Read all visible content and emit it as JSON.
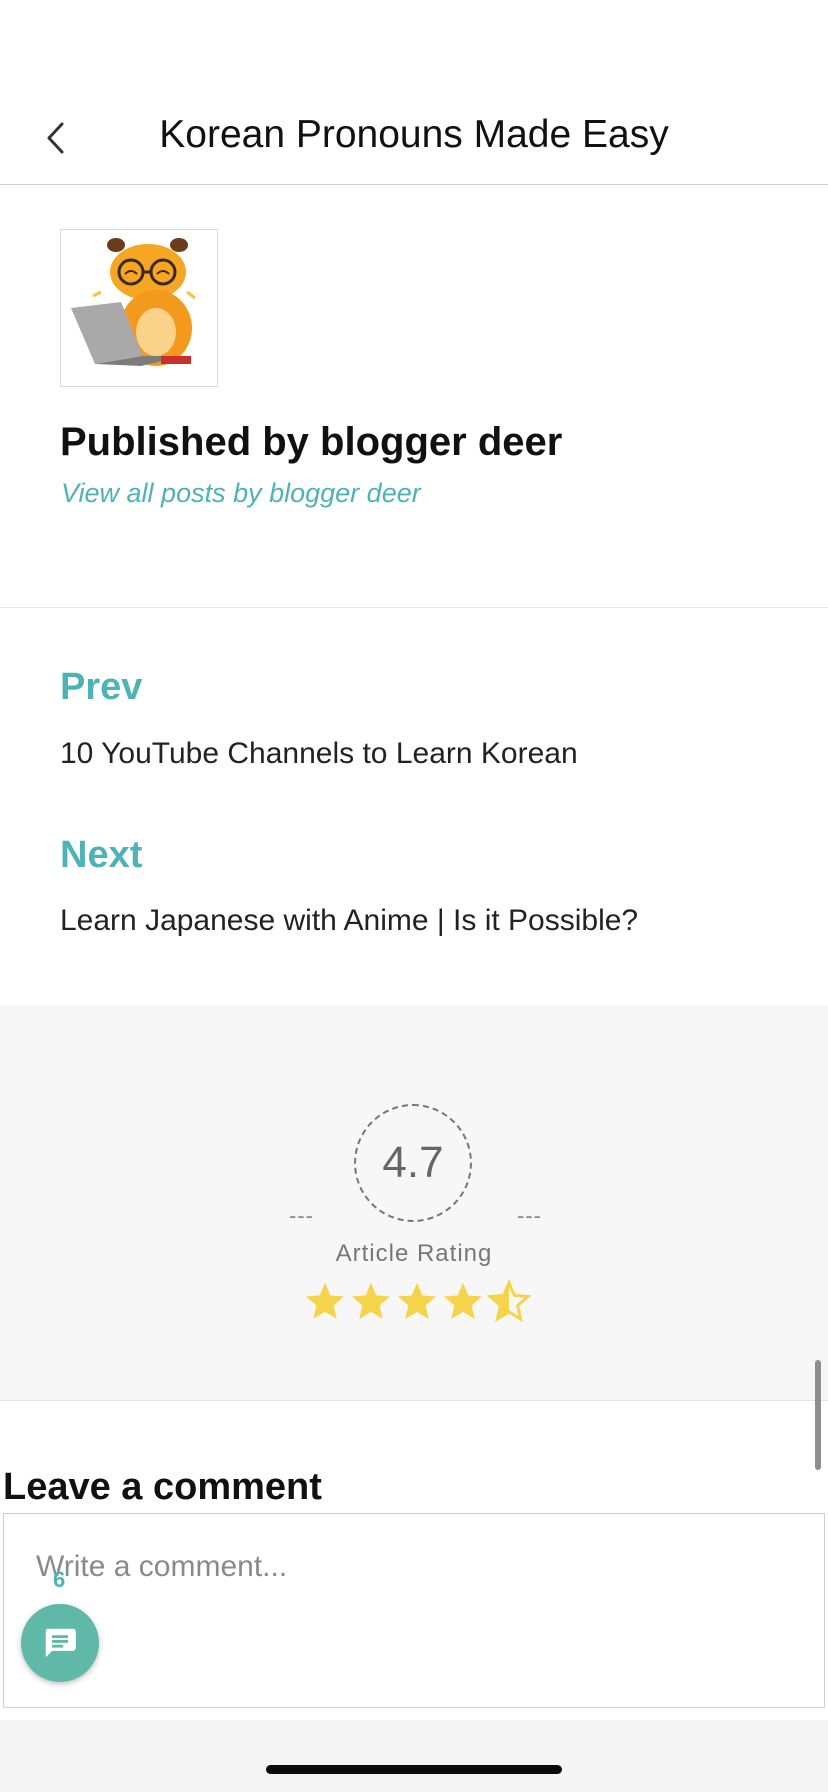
{
  "header": {
    "title": "Korean Pronouns Made Easy",
    "back_icon": "chevron-left-icon"
  },
  "author": {
    "published_by": "Published by blogger deer",
    "view_all": "View all posts by blogger deer"
  },
  "post_nav": {
    "prev_label": "Prev",
    "prev_title": "10 YouTube Channels to Learn Korean",
    "next_label": "Next",
    "next_title": "Learn Japanese with Anime | Is it Possible?"
  },
  "rating": {
    "value": "4.7",
    "label": "Article Rating",
    "dash_left": "---",
    "dash_right": "---",
    "stars_out_of": 5,
    "star_color": "#f5d34b"
  },
  "comment": {
    "heading": "Leave a comment",
    "placeholder": "Write a comment...",
    "count": "6",
    "fab_icon": "comment-icon"
  },
  "colors": {
    "accent": "#4fb3b5",
    "fab": "#5fb8a8"
  }
}
